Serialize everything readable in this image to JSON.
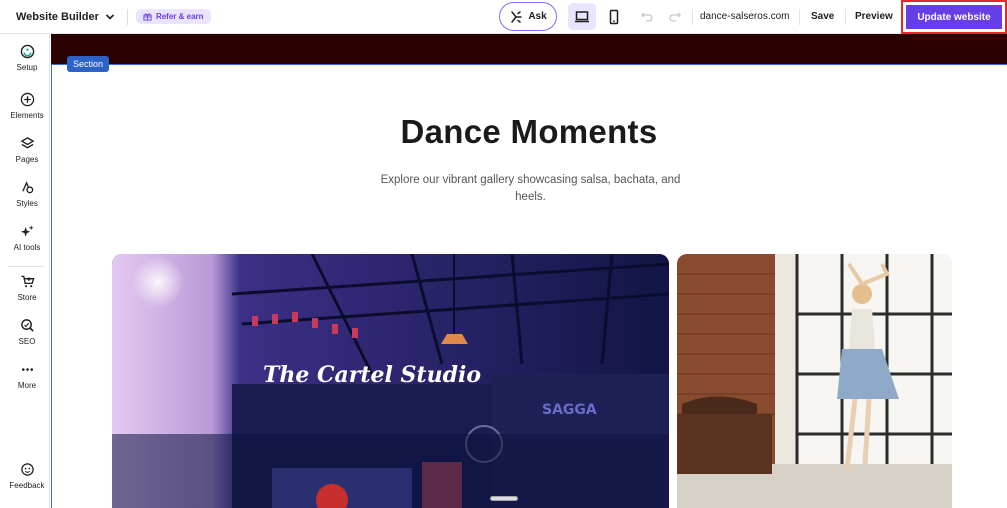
{
  "topbar": {
    "app_name": "Website Builder",
    "refer_label": "Refer & earn",
    "ask_label": "Ask",
    "domain": "dance-salseros.com",
    "save_label": "Save",
    "preview_label": "Preview",
    "update_label": "Update website",
    "active_device": "desktop"
  },
  "sidebar": {
    "items": [
      {
        "label": "Setup",
        "icon": "setup-icon"
      },
      {
        "label": "Elements",
        "icon": "plus-circle-icon"
      },
      {
        "label": "Pages",
        "icon": "layers-icon"
      },
      {
        "label": "Styles",
        "icon": "styles-icon"
      },
      {
        "label": "AI tools",
        "icon": "sparkle-icon"
      },
      {
        "label": "Store",
        "icon": "cart-icon"
      },
      {
        "label": "SEO",
        "icon": "seo-icon"
      },
      {
        "label": "More",
        "icon": "more-icon"
      }
    ],
    "feedback_label": "Feedback"
  },
  "canvas": {
    "section_label": "Section",
    "heading": "Dance Moments",
    "subtext": "Explore our vibrant gallery showcasing salsa, bachata, and heels.",
    "photo1_sign": "The Cartel Studio",
    "colors": {
      "accent": "#673de6",
      "header_strip": "#2a0202",
      "section_outline": "#3b6fd4",
      "highlight_border": "#e12b2b"
    }
  }
}
